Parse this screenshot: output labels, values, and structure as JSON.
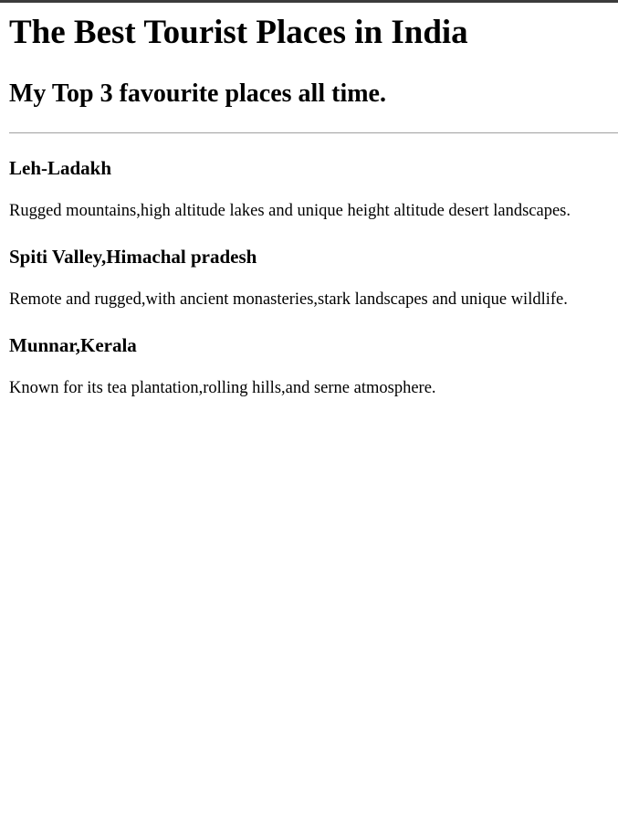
{
  "page": {
    "title": "The Best Tourist Places in India",
    "subtitle": "My Top 3 favourite places all time."
  },
  "places": [
    {
      "name": "Leh-Ladakh",
      "description": "Rugged mountains,high altitude lakes and unique height altitude desert landscapes."
    },
    {
      "name": "Spiti Valley,Himachal pradesh",
      "description": "Remote and rugged,with ancient monasteries,stark landscapes and unique wildlife."
    },
    {
      "name": "Munnar,Kerala",
      "description": "Known for its tea plantation,rolling hills,and serne atmosphere."
    }
  ]
}
